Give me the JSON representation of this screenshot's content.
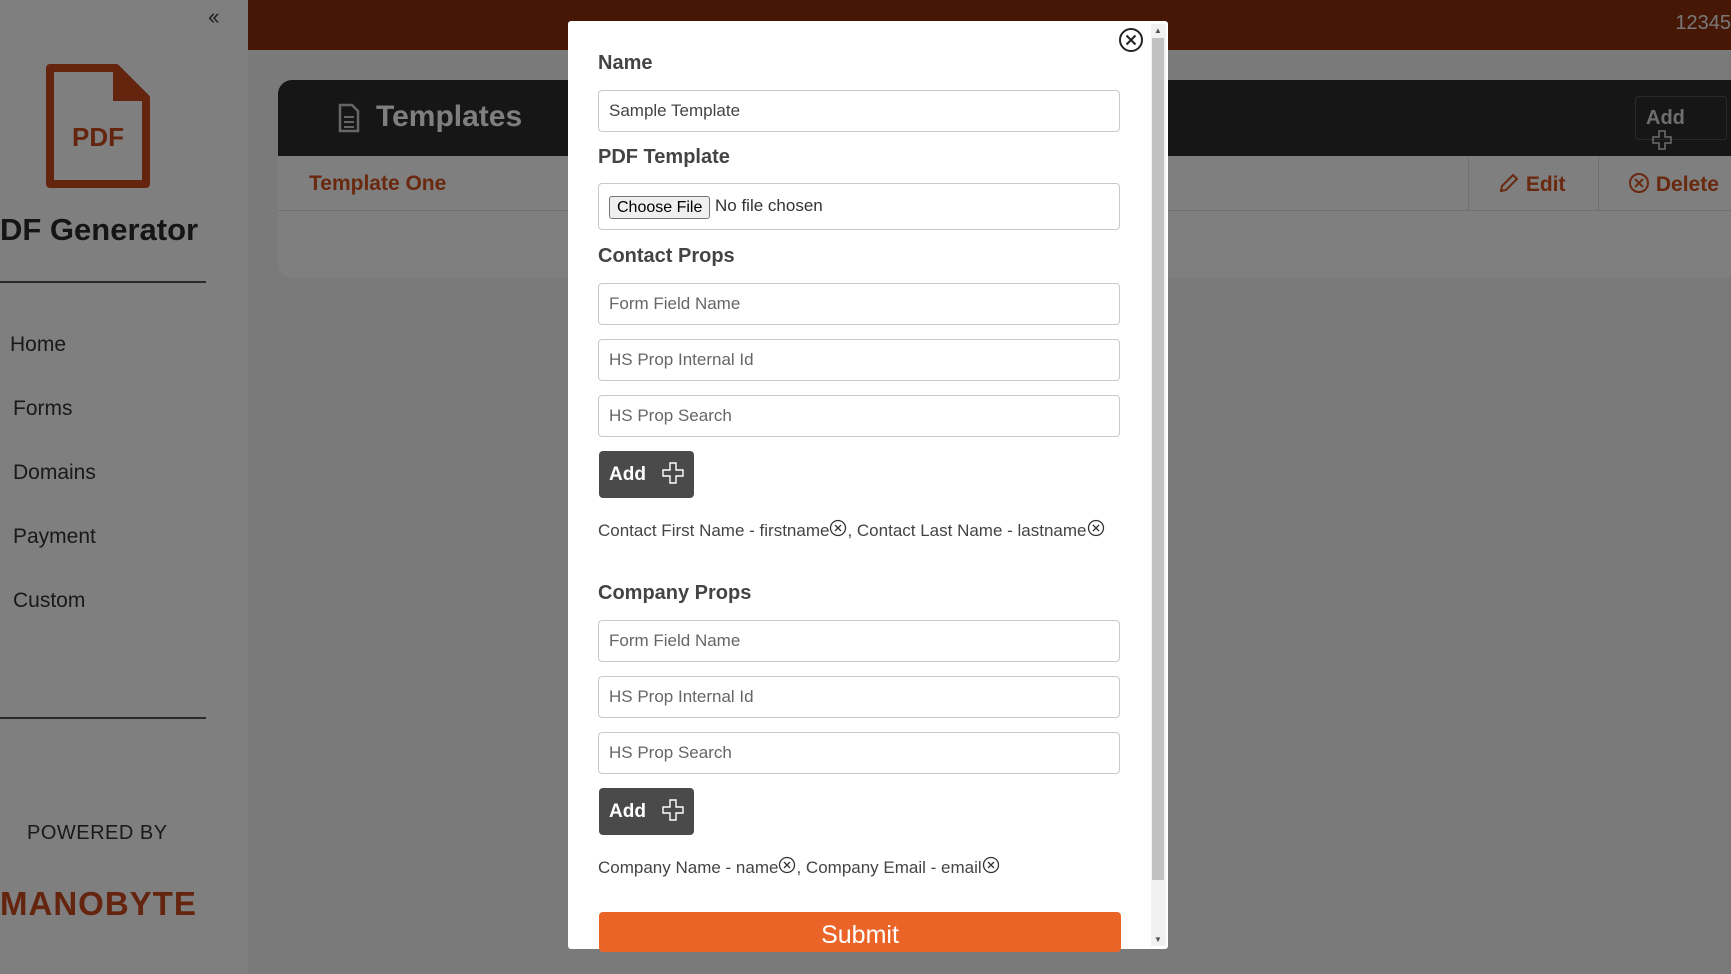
{
  "sidebar": {
    "collapse_icon": "double-chevron-left-icon",
    "logo_icon": "pdf-document-icon",
    "logo_text": "PDF",
    "brand": "DF Generator",
    "nav": [
      "Home",
      "Forms",
      "Domains",
      "Payment",
      "Custom"
    ],
    "powered_by": "POWERED BY",
    "company_logo": "MANOBYTE"
  },
  "topbar": {
    "text": "12345",
    "color": "#8e2f0b"
  },
  "templates": {
    "title": "Templates",
    "add_label": "Add",
    "rows": [
      {
        "name": "Template One",
        "edit_label": "Edit",
        "delete_label": "Delete"
      }
    ]
  },
  "modal": {
    "name_label": "Name",
    "name_value": "Sample Template",
    "pdf_label": "PDF Template",
    "choose_file_label": "Choose File",
    "file_status": "No file chosen",
    "contact": {
      "title": "Contact Props",
      "field_placeholder": "Form Field Name",
      "internal_placeholder": "HS Prop Internal Id",
      "search_placeholder": "HS Prop Search",
      "add_label": "Add",
      "items": [
        "Contact First Name - firstname",
        "Contact Last Name - lastname"
      ]
    },
    "company": {
      "title": "Company Props",
      "field_placeholder": "Form Field Name",
      "internal_placeholder": "HS Prop Internal Id",
      "search_placeholder": "HS Prop Search",
      "add_label": "Add",
      "items": [
        "Company Name - name",
        "Company Email - email"
      ]
    },
    "submit_label": "Submit",
    "accent_color": "#ea6428"
  }
}
